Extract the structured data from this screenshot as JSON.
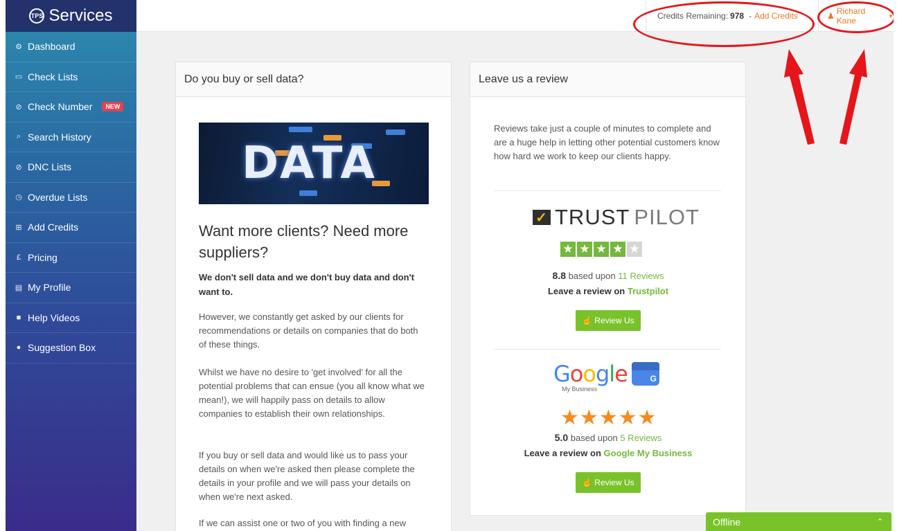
{
  "brand": {
    "logo": "TPS",
    "name": "Services"
  },
  "sidebar": {
    "items": [
      {
        "label": "Dashboard",
        "icon": "dashboard-icon",
        "glyph": "⚙"
      },
      {
        "label": "Check Lists",
        "icon": "folder-icon",
        "glyph": "▭"
      },
      {
        "label": "Check Number",
        "icon": "check-circle-icon",
        "glyph": "⊘",
        "badge": "NEW"
      },
      {
        "label": "Search History",
        "icon": "search-icon",
        "glyph": "⌕"
      },
      {
        "label": "DNC Lists",
        "icon": "ban-icon",
        "glyph": "⊘"
      },
      {
        "label": "Overdue Lists",
        "icon": "clock-icon",
        "glyph": "◷"
      },
      {
        "label": "Add Credits",
        "icon": "cart-icon",
        "glyph": "⊞"
      },
      {
        "label": "Pricing",
        "icon": "pound-icon",
        "glyph": "£"
      },
      {
        "label": "My Profile",
        "icon": "id-card-icon",
        "glyph": "▤"
      },
      {
        "label": "Help Videos",
        "icon": "video-icon",
        "glyph": "■"
      },
      {
        "label": "Suggestion Box",
        "icon": "comment-icon",
        "glyph": "●"
      }
    ]
  },
  "topbar": {
    "credits_label": "Credits Remaining:",
    "credits_value": "978",
    "separator": "-",
    "add_credits": "Add Credits",
    "user_name": "Richard Kane"
  },
  "left_panel": {
    "title": "Do you buy or sell data?",
    "image_word": "DATA",
    "heading": "Want more clients? Need more suppliers?",
    "lead": "We don't sell data and we don't buy data and don't want to.",
    "paragraphs": [
      "However, we constantly get asked by our clients for recommendations or details on companies that do both of these things.",
      "Whilst we have no desire to 'get involved' for all the potential problems that can ensue (you all know what we mean!), we will happily pass on details to allow companies to establish their own relationships.",
      "If you buy or sell data and would like us to pass your details on when we're asked then please complete the details in your profile and we will pass your details on when we're next asked.",
      "If we can assist one or two of you with finding a new"
    ]
  },
  "right_panel": {
    "title": "Leave us a review",
    "intro": "Reviews take just a couple of minutes to complete and are a huge help in letting other potential customers know how hard we work to keep our clients happy.",
    "trustpilot": {
      "logo_trust": "TRUST",
      "logo_pilot": "PILOT",
      "stars": 4,
      "max_stars": 5,
      "score": "8.8",
      "based_upon": "based upon",
      "reviews_link": "11 Reviews",
      "leave_text": "Leave a review on",
      "leave_link": "Trustpilot",
      "button": "Review Us"
    },
    "google": {
      "logo_word": "Google",
      "logo_sub": "My Business",
      "stars": 5,
      "score": "5.0",
      "based_upon": "based upon",
      "reviews_link": "5 Reviews",
      "leave_text": "Leave a review on",
      "leave_link": "Google My Business",
      "button": "Review Us"
    }
  },
  "chat": {
    "label": "Offline"
  },
  "colors": {
    "accent_orange": "#ee7722",
    "accent_green": "#79c229",
    "annotation_red": "#e5151a",
    "sidebar_top": "#2c8db0",
    "sidebar_bottom": "#3a2c8a"
  }
}
